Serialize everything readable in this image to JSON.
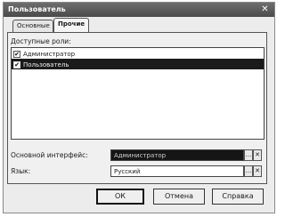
{
  "window": {
    "title": "Пользователь",
    "close_glyph": "✕"
  },
  "tabs": [
    {
      "label": "Основные",
      "active": false
    },
    {
      "label": "Прочие",
      "active": true
    }
  ],
  "roles": {
    "label": "Доступные роли:",
    "items": [
      {
        "label": "Администратор",
        "checked": true,
        "selected": false,
        "check_glyph": "✔"
      },
      {
        "label": "Пользователь",
        "checked": true,
        "selected": true,
        "check_glyph": "✔"
      }
    ]
  },
  "fields": {
    "main_interface": {
      "label": "Основной интерфейс:",
      "value": "Администратор",
      "select_glyph": "...",
      "clear_glyph": "✕"
    },
    "language": {
      "label": "Язык:",
      "value": "Русский",
      "select_glyph": "...",
      "clear_glyph": "✕"
    }
  },
  "buttons": {
    "ok": "ОК",
    "cancel": "Отмена",
    "help": "Справка"
  }
}
